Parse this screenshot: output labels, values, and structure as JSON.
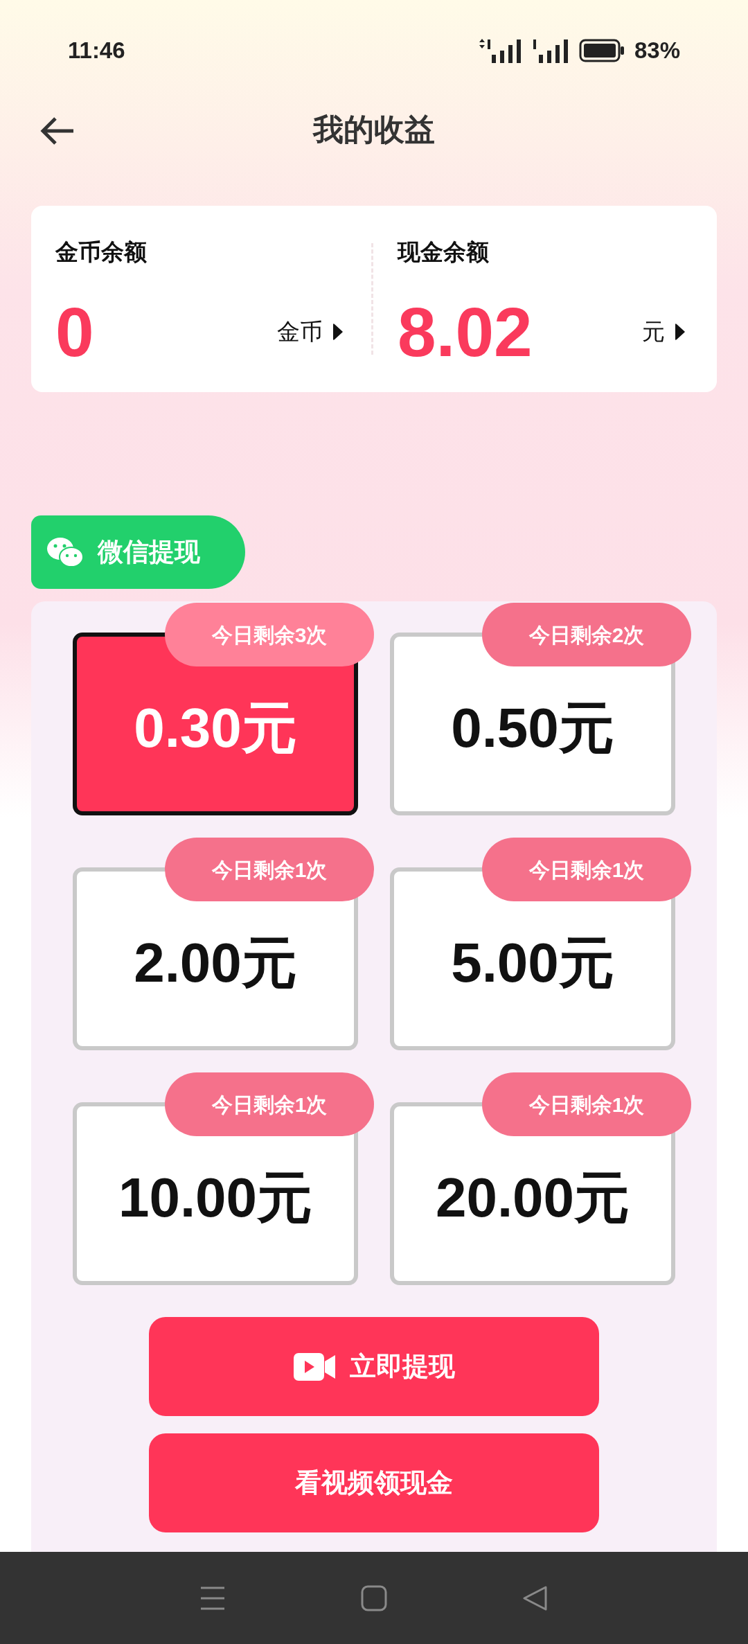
{
  "status_bar": {
    "time": "11:46",
    "battery": "83%"
  },
  "header": {
    "title": "我的收益"
  },
  "balances": [
    {
      "label": "金币余额",
      "amount": "0",
      "unit": "金币"
    },
    {
      "label": "现金余额",
      "amount": "8.02",
      "unit": "元"
    }
  ],
  "withdraw_tab": {
    "label": "微信提现"
  },
  "options": [
    {
      "amount": "0.30元",
      "badge": "今日剩余3次",
      "selected": true
    },
    {
      "amount": "0.50元",
      "badge": "今日剩余2次",
      "selected": false
    },
    {
      "amount": "2.00元",
      "badge": "今日剩余1次",
      "selected": false
    },
    {
      "amount": "5.00元",
      "badge": "今日剩余1次",
      "selected": false
    },
    {
      "amount": "10.00元",
      "badge": "今日剩余1次",
      "selected": false
    },
    {
      "amount": "20.00元",
      "badge": "今日剩余1次",
      "selected": false
    }
  ],
  "buttons": [
    {
      "label": "立即提现",
      "kind": "video"
    },
    {
      "label": "看视频领现金",
      "kind": "plain"
    }
  ]
}
